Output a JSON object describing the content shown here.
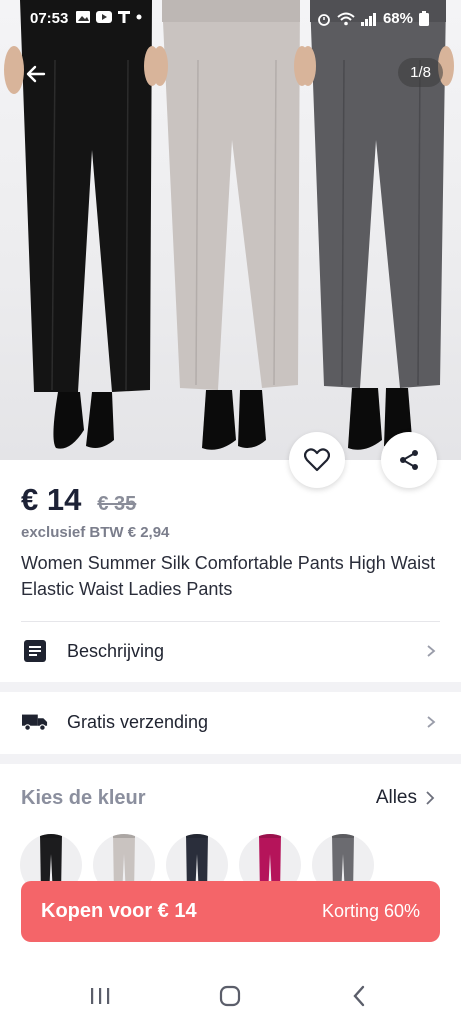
{
  "status_bar": {
    "time": "07:53",
    "battery": "68%"
  },
  "gallery": {
    "counter": "1/8"
  },
  "product": {
    "price": "€ 14",
    "old_price": "€ 35",
    "vat": "exclusief BTW € 2,94",
    "title": "Women Summer Silk Comfortable Pants High Waist Elastic Waist Ladies Pants"
  },
  "rows": {
    "description": "Beschrijving",
    "shipping": "Gratis verzending"
  },
  "color_section": {
    "title": "Kies de kleur",
    "all_label": "Alles",
    "swatch_colors": [
      "#1c1c1e",
      "#c9c3c0",
      "#2a2e3b",
      "#b5145a",
      "#6b6b70"
    ]
  },
  "buy_bar": {
    "label": "Kopen voor € 14",
    "discount": "Korting 60%",
    "color": "#f46569"
  },
  "icons": [
    "back-arrow-icon",
    "heart-icon",
    "share-icon",
    "description-icon",
    "truck-icon",
    "chevron-right-icon",
    "recents-icon",
    "home-icon",
    "back-icon"
  ]
}
